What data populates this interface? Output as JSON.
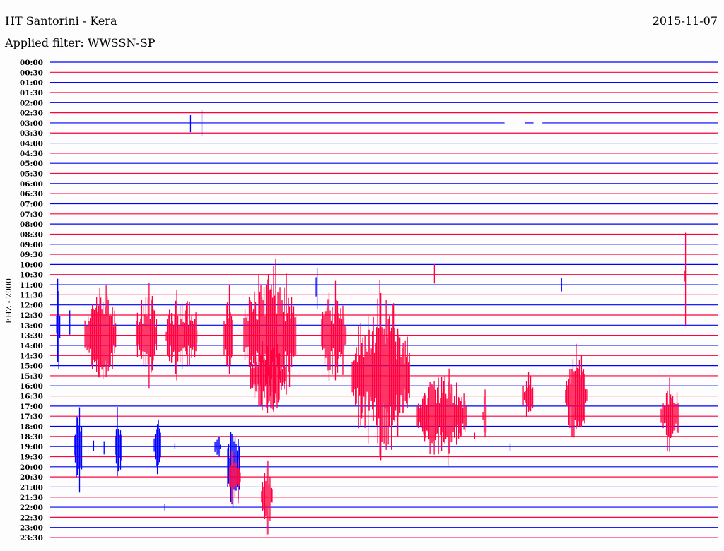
{
  "header": {
    "station": "HT Santorini - Kera",
    "filter": "Applied filter: WWSSN-SP",
    "date": "2015-11-07"
  },
  "chart_data": {
    "type": "line",
    "subtype": "helicorder",
    "title": "HT Santorini - Kera",
    "ylabel": "EHZ - 2000",
    "minutes_per_row": 30,
    "row_colors": [
      "#0000ff",
      "#ff0040"
    ],
    "rows": [
      "00:00",
      "00:30",
      "01:00",
      "01:30",
      "02:00",
      "02:30",
      "03:00",
      "03:30",
      "04:00",
      "04:30",
      "05:00",
      "05:30",
      "06:00",
      "06:30",
      "07:00",
      "07:30",
      "08:00",
      "08:30",
      "09:00",
      "09:30",
      "10:00",
      "10:30",
      "11:00",
      "11:30",
      "12:00",
      "12:30",
      "13:00",
      "13:30",
      "14:00",
      "14:30",
      "15:00",
      "15:30",
      "16:00",
      "16:30",
      "17:00",
      "17:30",
      "18:00",
      "18:30",
      "19:00",
      "19:30",
      "20:00",
      "20:30",
      "21:00",
      "21:30",
      "22:00",
      "22:30",
      "23:00",
      "23:30"
    ],
    "gaps": [
      {
        "row": 6,
        "start_min": 20.4,
        "end_min": 21.3
      },
      {
        "row": 6,
        "start_min": 21.7,
        "end_min": 22.1
      }
    ],
    "events": [
      {
        "row": 6,
        "start_min": 6.3,
        "end_min": 6.34,
        "amp": 3.8
      },
      {
        "row": 6,
        "start_min": 6.81,
        "end_min": 6.85,
        "amp": 3.8
      },
      {
        "row": 26,
        "start_min": 0.29,
        "end_min": 0.44,
        "amp": 6
      },
      {
        "row": 26,
        "start_min": 0.88,
        "end_min": 0.92,
        "amp": 4.5
      },
      {
        "row": 38,
        "start_min": 1.08,
        "end_min": 1.46,
        "amp": 5
      },
      {
        "row": 38,
        "start_min": 1.95,
        "end_min": 1.99,
        "amp": 2
      },
      {
        "row": 38,
        "start_min": 2.42,
        "end_min": 2.46,
        "amp": 3.3
      },
      {
        "row": 38,
        "start_min": 2.92,
        "end_min": 3.21,
        "amp": 5.5
      },
      {
        "row": 38,
        "start_min": 4.67,
        "end_min": 4.98,
        "amp": 3.3
      },
      {
        "row": 38,
        "start_min": 5.6,
        "end_min": 5.64,
        "amp": 1
      },
      {
        "row": 44,
        "start_min": 5.15,
        "end_min": 5.19,
        "amp": 2.3
      },
      {
        "row": 38,
        "start_min": 7.4,
        "end_min": 7.65,
        "amp": 1.8
      },
      {
        "row": 40,
        "start_min": 7.97,
        "end_min": 8.54,
        "amp": 6
      },
      {
        "row": 22,
        "start_min": 11.94,
        "end_min": 12.03,
        "amp": 5
      },
      {
        "row": 22,
        "start_min": 22.96,
        "end_min": 23.0,
        "amp": 5
      },
      {
        "row": 38,
        "start_min": 20.65,
        "end_min": 20.69,
        "amp": 3.5
      },
      {
        "row": 27,
        "start_min": 1.56,
        "end_min": 2.98,
        "amp": 5.5
      },
      {
        "row": 27,
        "start_min": 3.87,
        "end_min": 4.79,
        "amp": 5.5
      },
      {
        "row": 27,
        "start_min": 5.21,
        "end_min": 6.63,
        "amp": 5
      },
      {
        "row": 27,
        "start_min": 7.81,
        "end_min": 8.22,
        "amp": 6
      },
      {
        "row": 41,
        "start_min": 8.06,
        "end_min": 8.54,
        "amp": 3.5
      },
      {
        "row": 27,
        "start_min": 8.7,
        "end_min": 11.08,
        "amp": 8
      },
      {
        "row": 31,
        "start_min": 9.0,
        "end_min": 10.6,
        "amp": 4
      },
      {
        "row": 43,
        "start_min": 9.49,
        "end_min": 9.97,
        "amp": 4.5
      },
      {
        "row": 27,
        "start_min": 12.19,
        "end_min": 13.3,
        "amp": 6.5
      },
      {
        "row": 31,
        "start_min": 13.56,
        "end_min": 16.16,
        "amp": 9
      },
      {
        "row": 35,
        "start_min": 16.48,
        "end_min": 18.7,
        "amp": 5
      },
      {
        "row": 21,
        "start_min": 17.25,
        "end_min": 17.29,
        "amp": 5
      },
      {
        "row": 37,
        "start_min": 19.06,
        "end_min": 19.1,
        "amp": 2
      },
      {
        "row": 35,
        "start_min": 19.43,
        "end_min": 19.59,
        "amp": 4
      },
      {
        "row": 33,
        "start_min": 21.24,
        "end_min": 21.71,
        "amp": 3
      },
      {
        "row": 33,
        "start_min": 23.14,
        "end_min": 24.1,
        "amp": 5.5
      },
      {
        "row": 35,
        "start_min": 27.43,
        "end_min": 28.22,
        "amp": 4.5
      },
      {
        "row": 21,
        "start_min": 28.48,
        "end_min": 28.57,
        "amp": 5
      }
    ]
  }
}
